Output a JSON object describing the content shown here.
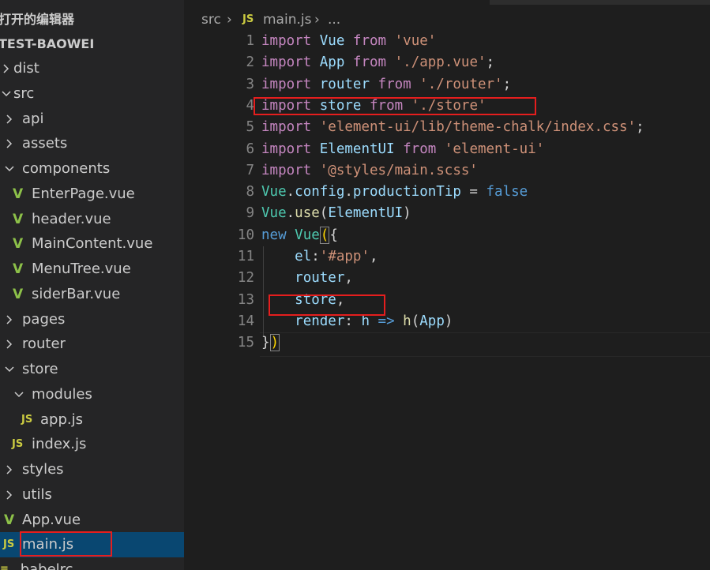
{
  "explorer": {
    "open_editors_label": "打开的编辑器",
    "project_label": "TEST-BAOWEI",
    "items": [
      {
        "label": "dist",
        "type": "folder",
        "expanded": false,
        "depth": 0
      },
      {
        "label": "src",
        "type": "folder",
        "expanded": true,
        "depth": 0
      },
      {
        "label": "api",
        "type": "folder",
        "expanded": false,
        "depth": 1
      },
      {
        "label": "assets",
        "type": "folder",
        "expanded": false,
        "depth": 1
      },
      {
        "label": "components",
        "type": "folder",
        "expanded": true,
        "depth": 1
      },
      {
        "label": "EnterPage.vue",
        "type": "vue",
        "depth": 2
      },
      {
        "label": "header.vue",
        "type": "vue",
        "depth": 2
      },
      {
        "label": "MainContent.vue",
        "type": "vue",
        "depth": 2
      },
      {
        "label": "MenuTree.vue",
        "type": "vue",
        "depth": 2
      },
      {
        "label": "siderBar.vue",
        "type": "vue",
        "depth": 2
      },
      {
        "label": "pages",
        "type": "folder",
        "expanded": false,
        "depth": 1
      },
      {
        "label": "router",
        "type": "folder",
        "expanded": false,
        "depth": 1
      },
      {
        "label": "store",
        "type": "folder",
        "expanded": true,
        "depth": 1
      },
      {
        "label": "modules",
        "type": "folder",
        "expanded": true,
        "depth": 2
      },
      {
        "label": "app.js",
        "type": "js",
        "depth": 3
      },
      {
        "label": "index.js",
        "type": "js",
        "depth": 2
      },
      {
        "label": "styles",
        "type": "folder",
        "expanded": false,
        "depth": 1
      },
      {
        "label": "utils",
        "type": "folder",
        "expanded": false,
        "depth": 1
      },
      {
        "label": "App.vue",
        "type": "vue",
        "depth": 1
      },
      {
        "label": "main.js",
        "type": "js",
        "depth": 1,
        "selected": true
      },
      {
        "label": ".babelrc",
        "type": "babel",
        "depth": 0
      }
    ]
  },
  "breadcrumb": {
    "folder": "src",
    "sep": "›",
    "file_icon": "JS",
    "file": "main.js",
    "more": "..."
  },
  "icons": {
    "js": "JS",
    "vue": "V",
    "chevron_right": "chevron-right-icon",
    "chevron_down": "chevron-down-icon"
  },
  "colors": {
    "keyword": "#c586c0",
    "string": "#ce9178",
    "variable": "#9cdcfe",
    "type": "#4ec9b0",
    "constant": "#569cd6",
    "function": "#dcdcaa",
    "highlight_box": "#e51e1e",
    "selection": "#094771",
    "js_icon": "#cbcb41",
    "vue_icon": "#8dc149"
  },
  "code": {
    "lines": [
      {
        "n": "1",
        "tokens": [
          [
            "kw",
            "import"
          ],
          [
            "pl",
            " "
          ],
          [
            "vb",
            "Vue"
          ],
          [
            "pl",
            " "
          ],
          [
            "kw",
            "from"
          ],
          [
            "pl",
            " "
          ],
          [
            "st",
            "'vue'"
          ]
        ]
      },
      {
        "n": "2",
        "tokens": [
          [
            "kw",
            "import"
          ],
          [
            "pl",
            " "
          ],
          [
            "vb",
            "App"
          ],
          [
            "pl",
            " "
          ],
          [
            "kw",
            "from"
          ],
          [
            "pl",
            " "
          ],
          [
            "st",
            "'./app.vue'"
          ],
          [
            "pl",
            ";"
          ]
        ]
      },
      {
        "n": "3",
        "tokens": [
          [
            "kw",
            "import"
          ],
          [
            "pl",
            " "
          ],
          [
            "vb",
            "router"
          ],
          [
            "pl",
            " "
          ],
          [
            "kw",
            "from"
          ],
          [
            "pl",
            " "
          ],
          [
            "st",
            "'./router'"
          ],
          [
            "pl",
            ";"
          ]
        ]
      },
      {
        "n": "4",
        "tokens": [
          [
            "kw",
            "import"
          ],
          [
            "pl",
            " "
          ],
          [
            "vb",
            "store"
          ],
          [
            "pl",
            " "
          ],
          [
            "kw",
            "from"
          ],
          [
            "pl",
            " "
          ],
          [
            "st",
            "'./store'"
          ]
        ]
      },
      {
        "n": "5",
        "tokens": [
          [
            "kw",
            "import"
          ],
          [
            "pl",
            " "
          ],
          [
            "st",
            "'element-ui/lib/theme-chalk/index.css'"
          ],
          [
            "pl",
            ";"
          ]
        ]
      },
      {
        "n": "6",
        "tokens": [
          [
            "kw",
            "import"
          ],
          [
            "pl",
            " "
          ],
          [
            "vb",
            "ElementUI"
          ],
          [
            "pl",
            " "
          ],
          [
            "kw",
            "from"
          ],
          [
            "pl",
            " "
          ],
          [
            "st",
            "'element-ui'"
          ]
        ]
      },
      {
        "n": "7",
        "tokens": [
          [
            "kw",
            "import"
          ],
          [
            "pl",
            " "
          ],
          [
            "st",
            "'@styles/main.scss'"
          ]
        ]
      },
      {
        "n": "8",
        "tokens": [
          [
            "ty",
            "Vue"
          ],
          [
            "pl",
            "."
          ],
          [
            "vb",
            "config"
          ],
          [
            "pl",
            "."
          ],
          [
            "vb",
            "productionTip"
          ],
          [
            "pl",
            " = "
          ],
          [
            "bl",
            "false"
          ]
        ]
      },
      {
        "n": "9",
        "tokens": [
          [
            "ty",
            "Vue"
          ],
          [
            "pl",
            "."
          ],
          [
            "fn",
            "use"
          ],
          [
            "pl",
            "("
          ],
          [
            "vb",
            "ElementUI"
          ],
          [
            "pl",
            ")"
          ]
        ]
      },
      {
        "n": "10",
        "tokens": [
          [
            "bl",
            "new"
          ],
          [
            "pl",
            " "
          ],
          [
            "ty",
            "Vue"
          ],
          [
            "br",
            "("
          ],
          [
            "pl",
            "{"
          ]
        ]
      },
      {
        "n": "11",
        "tokens": [
          [
            "pl",
            "    "
          ],
          [
            "vb",
            "el"
          ],
          [
            "pl",
            ":"
          ],
          [
            "st",
            "'#app'"
          ],
          [
            "pl",
            ","
          ]
        ]
      },
      {
        "n": "12",
        "tokens": [
          [
            "pl",
            "    "
          ],
          [
            "vb",
            "router"
          ],
          [
            "pl",
            ","
          ]
        ]
      },
      {
        "n": "13",
        "tokens": [
          [
            "pl",
            "    "
          ],
          [
            "vb",
            "store"
          ],
          [
            "pl",
            ","
          ]
        ]
      },
      {
        "n": "14",
        "tokens": [
          [
            "pl",
            "    "
          ],
          [
            "vb",
            "render"
          ],
          [
            "pl",
            ": "
          ],
          [
            "vb",
            "h"
          ],
          [
            "pl",
            " "
          ],
          [
            "bl",
            "=>"
          ],
          [
            "pl",
            " "
          ],
          [
            "fn",
            "h"
          ],
          [
            "pl",
            "("
          ],
          [
            "vb",
            "App"
          ],
          [
            "pl",
            ")"
          ]
        ]
      },
      {
        "n": "15",
        "tokens": [
          [
            "pl",
            "}"
          ],
          [
            "br",
            ")"
          ]
        ]
      }
    ]
  }
}
